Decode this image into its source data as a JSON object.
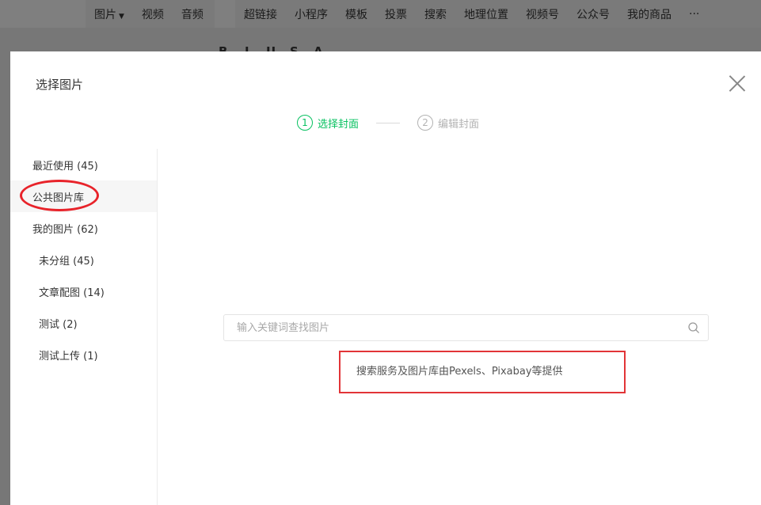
{
  "editor_toolbar": {
    "group1": [
      "图片",
      "视频",
      "音频"
    ],
    "group2": [
      "超链接",
      "小程序",
      "模板",
      "投票",
      "搜索",
      "地理位置",
      "视频号",
      "公众号",
      "我的商品"
    ],
    "more": "···"
  },
  "format_toolbar": [
    "B",
    "I",
    "U",
    "S",
    "A"
  ],
  "dialog": {
    "title": "选择图片",
    "steps": [
      {
        "number": "1",
        "label": "选择封面"
      },
      {
        "number": "2",
        "label": "编辑封面"
      }
    ],
    "sidebar": [
      {
        "label": "最近使用 (45)"
      },
      {
        "label": "公共图片库"
      },
      {
        "label": "我的图片 (62)"
      },
      {
        "label": "未分组 (45)"
      },
      {
        "label": "文章配图 (14)"
      },
      {
        "label": "测试 (2)"
      },
      {
        "label": "测试上传 (1)"
      }
    ],
    "search": {
      "placeholder": "输入关键词查找图片",
      "value": ""
    },
    "provider_note": "搜索服务及图片库由Pexels、Pixabay等提供"
  },
  "colors": {
    "accent": "#07c160",
    "annotation": "#e8232a"
  }
}
